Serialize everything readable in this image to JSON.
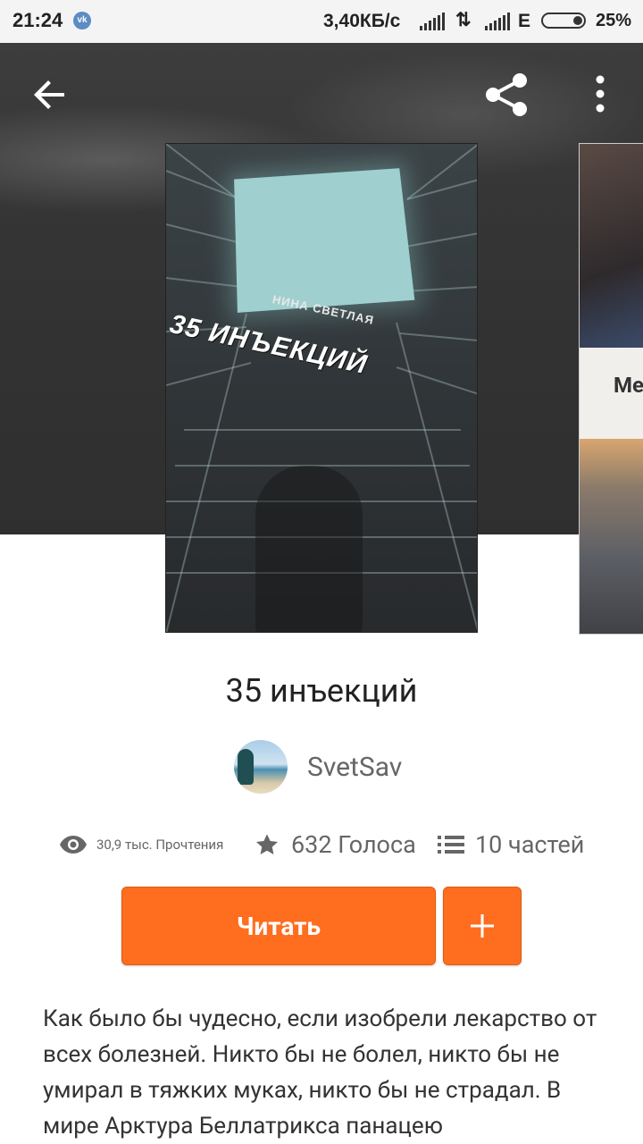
{
  "status_bar": {
    "time": "21:24",
    "vk_icon": "vk-icon",
    "speed": "3,40КБ/с",
    "network_e": "E",
    "battery": "25%"
  },
  "toolbar": {
    "back_icon": "arrow-left-icon",
    "share_icon": "share-icon",
    "more_icon": "more-vertical-icon"
  },
  "cover": {
    "author_text": "НИНА СВЕТЛАЯ",
    "title_text": "35 ИНЪЕКЦИЙ"
  },
  "next_cover": {
    "partial_text": "Ме"
  },
  "story": {
    "title": "35 инъекций",
    "author": "SvetSav",
    "reads": "30,9 тыс. Прочтения",
    "votes": "632 Голоса",
    "parts": "10 частей",
    "read_label": "Читать",
    "add_label": "+",
    "description": "Как было бы чудесно, если изобрели лекарство от всех болезней. Никто бы не болел, никто бы не умирал в тяжких муках, никто бы не страдал. В мире Арктура Беллатрикса панацею"
  },
  "colors": {
    "accent": "#ff6d1f",
    "hero_bg": "#343434",
    "text_primary": "#222222",
    "text_secondary": "#666666"
  }
}
